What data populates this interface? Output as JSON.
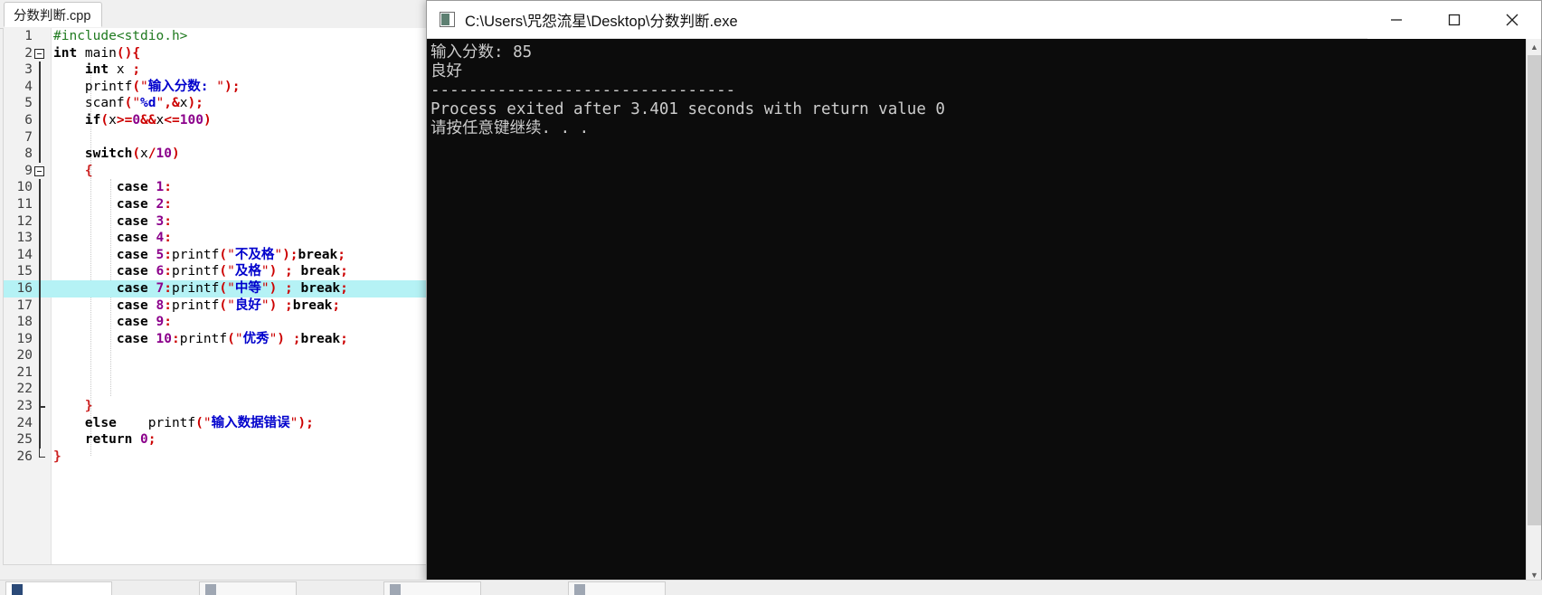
{
  "ide": {
    "tab_label": "分数判断.cpp",
    "gutter_first_line": 1,
    "highlighted_line": 16,
    "fold_markers": [
      2,
      9
    ],
    "fold_end_line": 26,
    "lines": [
      {
        "n": 1,
        "segments": [
          {
            "t": "#include<stdio.h>",
            "c": "c-pre"
          }
        ]
      },
      {
        "n": 2,
        "segments": [
          {
            "t": "int",
            "c": "c-kw"
          },
          {
            "t": " main",
            "c": "c-id"
          },
          {
            "t": "(){",
            "c": "c-punc"
          }
        ]
      },
      {
        "n": 3,
        "segments": [
          {
            "t": "    ",
            "c": "c-id"
          },
          {
            "t": "int",
            "c": "c-kw"
          },
          {
            "t": " x ",
            "c": "c-id"
          },
          {
            "t": ";",
            "c": "c-punc"
          }
        ]
      },
      {
        "n": 4,
        "segments": [
          {
            "t": "    printf",
            "c": "c-id"
          },
          {
            "t": "(",
            "c": "c-punc"
          },
          {
            "t": "\"",
            "c": "c-quote"
          },
          {
            "t": "输入分数: ",
            "c": "c-str"
          },
          {
            "t": "\"",
            "c": "c-quote"
          },
          {
            "t": ");",
            "c": "c-punc"
          }
        ]
      },
      {
        "n": 5,
        "segments": [
          {
            "t": "    scanf",
            "c": "c-id"
          },
          {
            "t": "(",
            "c": "c-punc"
          },
          {
            "t": "\"",
            "c": "c-quote"
          },
          {
            "t": "%d",
            "c": "c-str"
          },
          {
            "t": "\"",
            "c": "c-quote"
          },
          {
            "t": ",",
            "c": "c-punc"
          },
          {
            "t": "&",
            "c": "c-op"
          },
          {
            "t": "x",
            "c": "c-id"
          },
          {
            "t": ");",
            "c": "c-punc"
          }
        ]
      },
      {
        "n": 6,
        "segments": [
          {
            "t": "    ",
            "c": "c-id"
          },
          {
            "t": "if",
            "c": "c-kw"
          },
          {
            "t": "(",
            "c": "c-punc"
          },
          {
            "t": "x",
            "c": "c-id"
          },
          {
            "t": ">=",
            "c": "c-op"
          },
          {
            "t": "0",
            "c": "c-num"
          },
          {
            "t": "&&",
            "c": "c-op"
          },
          {
            "t": "x",
            "c": "c-id"
          },
          {
            "t": "<=",
            "c": "c-op"
          },
          {
            "t": "100",
            "c": "c-num"
          },
          {
            "t": ")",
            "c": "c-punc"
          }
        ]
      },
      {
        "n": 7,
        "segments": [
          {
            "t": "",
            "c": "c-id"
          }
        ]
      },
      {
        "n": 8,
        "segments": [
          {
            "t": "    ",
            "c": "c-id"
          },
          {
            "t": "switch",
            "c": "c-kw"
          },
          {
            "t": "(",
            "c": "c-punc"
          },
          {
            "t": "x",
            "c": "c-id"
          },
          {
            "t": "/",
            "c": "c-op"
          },
          {
            "t": "10",
            "c": "c-num"
          },
          {
            "t": ")",
            "c": "c-punc"
          }
        ]
      },
      {
        "n": 9,
        "segments": [
          {
            "t": "    ",
            "c": "c-id"
          },
          {
            "t": "{",
            "c": "c-brace"
          }
        ]
      },
      {
        "n": 10,
        "segments": [
          {
            "t": "        ",
            "c": "c-id"
          },
          {
            "t": "case",
            "c": "c-kw"
          },
          {
            "t": " ",
            "c": "c-id"
          },
          {
            "t": "1",
            "c": "c-num"
          },
          {
            "t": ":",
            "c": "c-punc"
          }
        ]
      },
      {
        "n": 11,
        "segments": [
          {
            "t": "        ",
            "c": "c-id"
          },
          {
            "t": "case",
            "c": "c-kw"
          },
          {
            "t": " ",
            "c": "c-id"
          },
          {
            "t": "2",
            "c": "c-num"
          },
          {
            "t": ":",
            "c": "c-punc"
          }
        ]
      },
      {
        "n": 12,
        "segments": [
          {
            "t": "        ",
            "c": "c-id"
          },
          {
            "t": "case",
            "c": "c-kw"
          },
          {
            "t": " ",
            "c": "c-id"
          },
          {
            "t": "3",
            "c": "c-num"
          },
          {
            "t": ":",
            "c": "c-punc"
          }
        ]
      },
      {
        "n": 13,
        "segments": [
          {
            "t": "        ",
            "c": "c-id"
          },
          {
            "t": "case",
            "c": "c-kw"
          },
          {
            "t": " ",
            "c": "c-id"
          },
          {
            "t": "4",
            "c": "c-num"
          },
          {
            "t": ":",
            "c": "c-punc"
          }
        ]
      },
      {
        "n": 14,
        "segments": [
          {
            "t": "        ",
            "c": "c-id"
          },
          {
            "t": "case",
            "c": "c-kw"
          },
          {
            "t": " ",
            "c": "c-id"
          },
          {
            "t": "5",
            "c": "c-num"
          },
          {
            "t": ":",
            "c": "c-punc"
          },
          {
            "t": "printf",
            "c": "c-id"
          },
          {
            "t": "(",
            "c": "c-punc"
          },
          {
            "t": "\"",
            "c": "c-quote"
          },
          {
            "t": "不及格",
            "c": "c-str"
          },
          {
            "t": "\"",
            "c": "c-quote"
          },
          {
            "t": ");",
            "c": "c-punc"
          },
          {
            "t": "break",
            "c": "c-kw"
          },
          {
            "t": ";",
            "c": "c-punc"
          }
        ]
      },
      {
        "n": 15,
        "segments": [
          {
            "t": "        ",
            "c": "c-id"
          },
          {
            "t": "case",
            "c": "c-kw"
          },
          {
            "t": " ",
            "c": "c-id"
          },
          {
            "t": "6",
            "c": "c-num"
          },
          {
            "t": ":",
            "c": "c-punc"
          },
          {
            "t": "printf",
            "c": "c-id"
          },
          {
            "t": "(",
            "c": "c-punc"
          },
          {
            "t": "\"",
            "c": "c-quote"
          },
          {
            "t": "及格",
            "c": "c-str"
          },
          {
            "t": "\"",
            "c": "c-quote"
          },
          {
            "t": ")",
            "c": "c-punc"
          },
          {
            "t": " ",
            "c": "c-id"
          },
          {
            "t": ";",
            "c": "c-punc"
          },
          {
            "t": " ",
            "c": "c-id"
          },
          {
            "t": "break",
            "c": "c-kw"
          },
          {
            "t": ";",
            "c": "c-punc"
          }
        ]
      },
      {
        "n": 16,
        "segments": [
          {
            "t": "        ",
            "c": "c-id"
          },
          {
            "t": "case",
            "c": "c-kw"
          },
          {
            "t": " ",
            "c": "c-id"
          },
          {
            "t": "7",
            "c": "c-num"
          },
          {
            "t": ":",
            "c": "c-punc"
          },
          {
            "t": "printf",
            "c": "c-id"
          },
          {
            "t": "(",
            "c": "c-punc"
          },
          {
            "t": "\"",
            "c": "c-quote"
          },
          {
            "t": "中等",
            "c": "c-str"
          },
          {
            "t": "\"",
            "c": "c-quote"
          },
          {
            "t": ")",
            "c": "c-punc"
          },
          {
            "t": " ",
            "c": "c-id"
          },
          {
            "t": ";",
            "c": "c-punc"
          },
          {
            "t": " ",
            "c": "c-id"
          },
          {
            "t": "break",
            "c": "c-kw"
          },
          {
            "t": ";",
            "c": "c-punc"
          }
        ]
      },
      {
        "n": 17,
        "segments": [
          {
            "t": "        ",
            "c": "c-id"
          },
          {
            "t": "case",
            "c": "c-kw"
          },
          {
            "t": " ",
            "c": "c-id"
          },
          {
            "t": "8",
            "c": "c-num"
          },
          {
            "t": ":",
            "c": "c-punc"
          },
          {
            "t": "printf",
            "c": "c-id"
          },
          {
            "t": "(",
            "c": "c-punc"
          },
          {
            "t": "\"",
            "c": "c-quote"
          },
          {
            "t": "良好",
            "c": "c-str"
          },
          {
            "t": "\"",
            "c": "c-quote"
          },
          {
            "t": ")",
            "c": "c-punc"
          },
          {
            "t": " ",
            "c": "c-id"
          },
          {
            "t": ";",
            "c": "c-punc"
          },
          {
            "t": "break",
            "c": "c-kw"
          },
          {
            "t": ";",
            "c": "c-punc"
          }
        ]
      },
      {
        "n": 18,
        "segments": [
          {
            "t": "        ",
            "c": "c-id"
          },
          {
            "t": "case",
            "c": "c-kw"
          },
          {
            "t": " ",
            "c": "c-id"
          },
          {
            "t": "9",
            "c": "c-num"
          },
          {
            "t": ":",
            "c": "c-punc"
          }
        ]
      },
      {
        "n": 19,
        "segments": [
          {
            "t": "        ",
            "c": "c-id"
          },
          {
            "t": "case",
            "c": "c-kw"
          },
          {
            "t": " ",
            "c": "c-id"
          },
          {
            "t": "10",
            "c": "c-num"
          },
          {
            "t": ":",
            "c": "c-punc"
          },
          {
            "t": "printf",
            "c": "c-id"
          },
          {
            "t": "(",
            "c": "c-punc"
          },
          {
            "t": "\"",
            "c": "c-quote"
          },
          {
            "t": "优秀",
            "c": "c-str"
          },
          {
            "t": "\"",
            "c": "c-quote"
          },
          {
            "t": ")",
            "c": "c-punc"
          },
          {
            "t": " ",
            "c": "c-id"
          },
          {
            "t": ";",
            "c": "c-punc"
          },
          {
            "t": "break",
            "c": "c-kw"
          },
          {
            "t": ";",
            "c": "c-punc"
          }
        ]
      },
      {
        "n": 20,
        "segments": [
          {
            "t": "",
            "c": "c-id"
          }
        ]
      },
      {
        "n": 21,
        "segments": [
          {
            "t": "",
            "c": "c-id"
          }
        ]
      },
      {
        "n": 22,
        "segments": [
          {
            "t": "",
            "c": "c-id"
          }
        ]
      },
      {
        "n": 23,
        "segments": [
          {
            "t": "    ",
            "c": "c-id"
          },
          {
            "t": "}",
            "c": "c-brace"
          }
        ]
      },
      {
        "n": 24,
        "segments": [
          {
            "t": "    ",
            "c": "c-id"
          },
          {
            "t": "else",
            "c": "c-kw"
          },
          {
            "t": "    printf",
            "c": "c-id"
          },
          {
            "t": "(",
            "c": "c-punc"
          },
          {
            "t": "\"",
            "c": "c-quote"
          },
          {
            "t": "输入数据错误",
            "c": "c-str"
          },
          {
            "t": "\"",
            "c": "c-quote"
          },
          {
            "t": ");",
            "c": "c-punc"
          }
        ]
      },
      {
        "n": 25,
        "segments": [
          {
            "t": "    ",
            "c": "c-id"
          },
          {
            "t": "return",
            "c": "c-kw"
          },
          {
            "t": " ",
            "c": "c-id"
          },
          {
            "t": "0",
            "c": "c-num"
          },
          {
            "t": ";",
            "c": "c-punc"
          }
        ]
      },
      {
        "n": 26,
        "segments": [
          {
            "t": "}",
            "c": "c-brace"
          }
        ]
      }
    ]
  },
  "console": {
    "title": "C:\\Users\\咒怨流星\\Desktop\\分数判断.exe",
    "icon_name": "console-app-icon",
    "controls": {
      "minimize_label": "Minimize",
      "maximize_label": "Maximize",
      "close_label": "Close"
    },
    "output": "输入分数: 85\n良好\n--------------------------------\nProcess exited after 3.401 seconds with return value 0\n请按任意键继续. . .",
    "output_lines": [
      "输入分数: 85",
      "良好",
      "--------------------------------",
      "Process exited after 3.401 seconds with return value 0",
      "请按任意键继续. . ."
    ],
    "prompt_text": "输入分数: ",
    "input_value": "85",
    "result_text": "良好",
    "exit_seconds": "3.401",
    "return_value": "0",
    "continue_text": "请按任意键继续. . ."
  },
  "taskbar": {
    "items": [
      {
        "name": "taskbar-item-explorer",
        "glyph": "folder-icon",
        "active": true
      },
      {
        "name": "taskbar-item-app2",
        "glyph": "window-icon",
        "active": false
      },
      {
        "name": "taskbar-item-app3",
        "glyph": "window-icon",
        "active": false
      },
      {
        "name": "taskbar-item-app4",
        "glyph": "window-icon",
        "active": false
      }
    ]
  },
  "colors": {
    "console_bg": "#0c0c0c",
    "console_fg": "#cccccc",
    "highlight_line": "#b5f2f5",
    "string_blue": "#0000cc",
    "quote_red": "#cc0000",
    "preproc_green": "#1f7a1f",
    "number_purple": "#8b008b"
  }
}
